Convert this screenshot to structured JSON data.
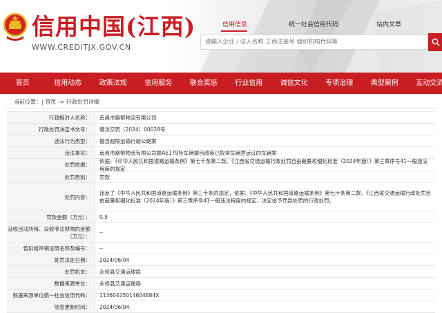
{
  "header": {
    "title": "信用中国(江西)",
    "url": "WWW.CREDITJX.GOV.CN",
    "links": [
      {
        "label": "信用信息",
        "active": true
      },
      {
        "label": "统一社会信用代码",
        "active": false
      },
      {
        "label": "站内文章",
        "active": false
      }
    ],
    "search_placeholder": "请输入企业 / 法人名称 工商注册号 组织机构代码等"
  },
  "nav": {
    "items": [
      "首页",
      "信用动态",
      "政策法规",
      "信用服务",
      "联合奖惩",
      "行业信用",
      "诚信文化",
      "专项治理",
      "典型案例",
      "互动交流"
    ]
  },
  "breadcrumb": "当前位置：| 首页 -> 行政处罚详细",
  "detail_rows": [
    {
      "label": "行政相对人名称：",
      "value": "南昌市路帮物流有限公司"
    },
    {
      "label": "行政处罚决定书文号：",
      "value": "赣洪交罚（2024）00028号"
    },
    {
      "label": "违法行为类型：",
      "value": "擅自超限运输行驶公路案"
    },
    {
      "label": "违法事实：",
      "value": "南昌市路帮物流有限公司赣AE179挂车辆擅自改装已取得车辆营运证的车辆案"
    },
    {
      "label": "处罚依据：",
      "value": "依据：《中华人民共和国道路运输条例》第七十条第二款、《江西省交通运输行政处罚自由裁量权细化标准（2024年版）》第三章序号41一般违法程度的规定"
    },
    {
      "label": "处罚类别：",
      "value": "罚款"
    },
    {
      "label": "处罚内容：",
      "value": "违反了《中华人民共和国道路运输条例》第三十条的规定，依据：《中华人民共和国道路运输条例》第七十条第二款、《江西省交通运输行政处罚自由裁量权细化标准（2024年版）》第三章序号41一般违法程度的规定，决定给予罚款处罚的行政处罚。"
    },
    {
      "label": "罚款金额（万元）：",
      "value": "0.5"
    },
    {
      "label": "没收违法所得、没收非法财物的金额（万元）：",
      "value": "--"
    },
    {
      "label": "暂扣或吊销证照名称及编号：",
      "value": "--"
    },
    {
      "label": "处罚决定日期：",
      "value": "2024/06/04"
    },
    {
      "label": "处罚机关：",
      "value": "永修县交通运输局"
    },
    {
      "label": "数据来源单位：",
      "value": "永修县交通运输局"
    },
    {
      "label": "数据来源单位统一社会信用代码：",
      "value": "11360425014604684X"
    },
    {
      "label": "信息更新时间：",
      "value": "2024/06/04"
    }
  ],
  "colors": {
    "brand_red": "#c81e23"
  }
}
